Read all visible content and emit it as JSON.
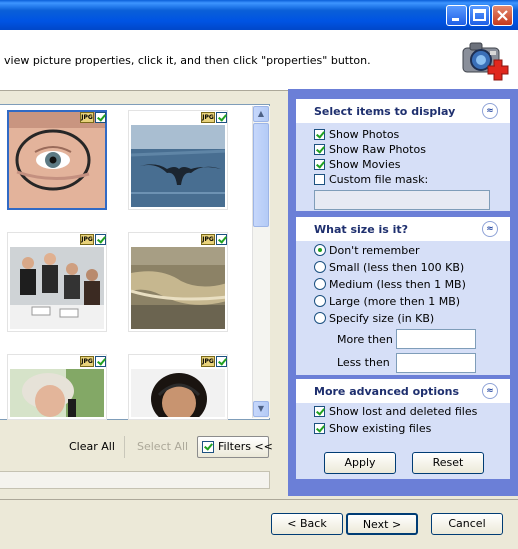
{
  "window": {
    "title": ""
  },
  "header": {
    "instruction": "view picture properties, click it, and then click \"properties\" button.",
    "logo_icon": "camera-plus-icon"
  },
  "thumbnails": [
    {
      "type_label": "JPG",
      "checked": true,
      "selected": true,
      "subject": "eye with glasses"
    },
    {
      "type_label": "JPG",
      "checked": true,
      "selected": false,
      "subject": "whale tail"
    },
    {
      "type_label": "JPG",
      "checked": true,
      "selected": false,
      "subject": "business meeting"
    },
    {
      "type_label": "JPG",
      "checked": true,
      "selected": false,
      "subject": "ocean wave"
    },
    {
      "type_label": "JPG",
      "checked": true,
      "selected": false,
      "subject": "woman on phone"
    },
    {
      "type_label": "JPG",
      "checked": true,
      "selected": false,
      "subject": "woman with headset"
    }
  ],
  "actions": {
    "clear_all": "Clear All",
    "select_all": "Select All",
    "filters": "Filters <<"
  },
  "options": {
    "display": {
      "title": "Select items to display",
      "items": [
        {
          "label": "Show Photos",
          "checked": true
        },
        {
          "label": "Show Raw Photos",
          "checked": true
        },
        {
          "label": "Show Movies",
          "checked": true
        },
        {
          "label": "Custom file mask:",
          "checked": false
        }
      ],
      "mask_value": ""
    },
    "size": {
      "title": "What size is it?",
      "items": [
        {
          "label": "Don't remember",
          "selected": true
        },
        {
          "label": "Small (less then 100 KB)",
          "selected": false
        },
        {
          "label": "Medium (less then 1 MB)",
          "selected": false
        },
        {
          "label": "Large (more then 1 MB)",
          "selected": false
        },
        {
          "label": "Specify size (in KB)",
          "selected": false
        }
      ],
      "more_than_label": "More then",
      "less_than_label": "Less then",
      "more_than_value": "",
      "less_than_value": ""
    },
    "advanced": {
      "title": "More advanced options",
      "items": [
        {
          "label": "Show lost and deleted files",
          "checked": true
        },
        {
          "label": "Show existing files",
          "checked": true
        }
      ]
    },
    "apply": "Apply",
    "reset": "Reset"
  },
  "footer": {
    "back": "< Back",
    "next": "Next >",
    "cancel": "Cancel"
  },
  "colors": {
    "titlebar": "#0054e3",
    "panel_bg": "#6b7fd7",
    "group_bg": "#d6dff7",
    "check_green": "#21a121"
  }
}
